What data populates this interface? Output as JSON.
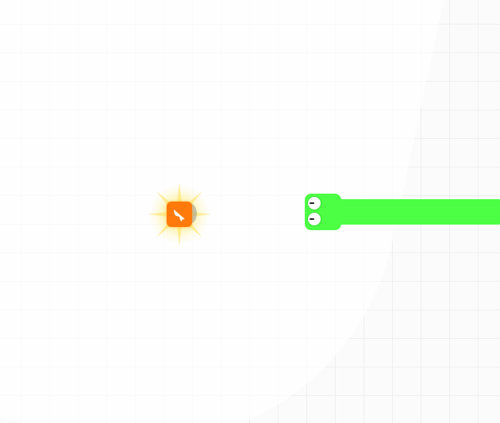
{
  "board": {
    "background": "#fbfbfb",
    "grid_line_color": "#efefef"
  },
  "powerup": {
    "type": "rocket",
    "icon": "rocket-icon",
    "color": "#ff7a0a",
    "glow_color": "#ffec78"
  },
  "snake": {
    "color": "#4cff44",
    "facing": "left",
    "eyes": 2
  }
}
